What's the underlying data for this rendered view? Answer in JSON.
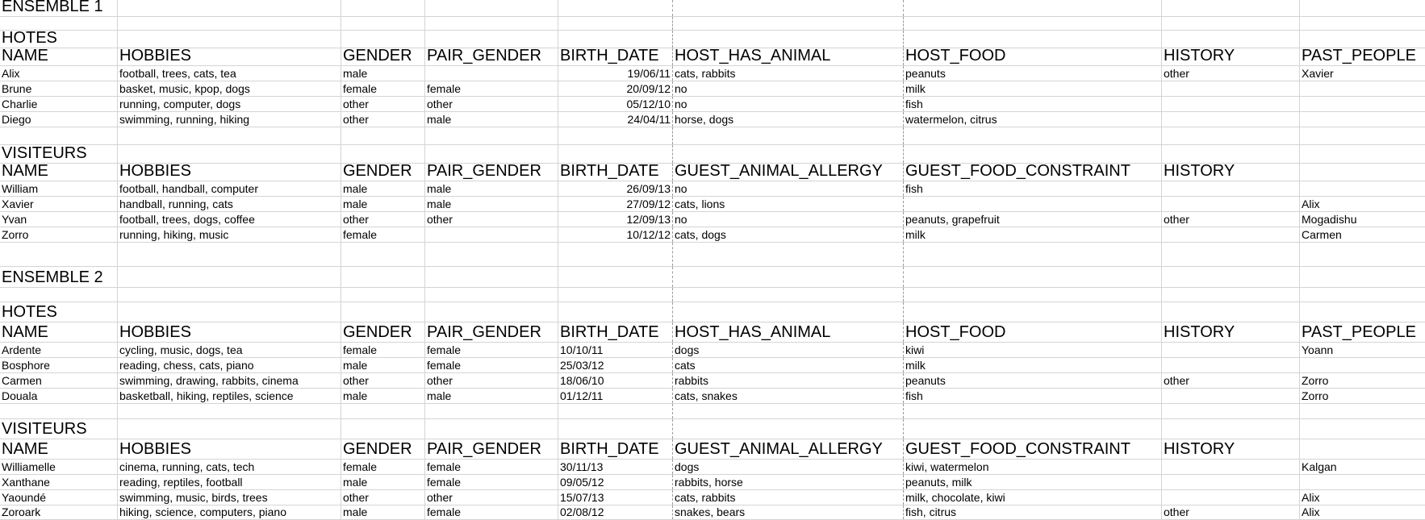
{
  "sheet": {
    "ensemble1": {
      "title": "ENSEMBLE 1",
      "hotes": {
        "title": "HOTES",
        "headers": [
          "NAME",
          "HOBBIES",
          "GENDER",
          "PAIR_GENDER",
          "BIRTH_DATE",
          "HOST_HAS_ANIMAL",
          "HOST_FOOD",
          "HISTORY",
          "PAST_PEOPLE"
        ],
        "rows": [
          [
            "Alix",
            "football, trees, cats, tea",
            "male",
            "",
            "19/06/11",
            "cats, rabbits",
            "peanuts",
            "other",
            "Xavier"
          ],
          [
            "Brune",
            "basket, music, kpop, dogs",
            "female",
            "female",
            "20/09/12",
            "no",
            "milk",
            "",
            ""
          ],
          [
            "Charlie",
            "running, computer, dogs",
            "other",
            "other",
            "05/12/10",
            "no",
            "fish",
            "",
            ""
          ],
          [
            "Diego",
            "swimming, running, hiking",
            "other",
            "male",
            "24/04/11",
            "horse, dogs",
            "watermelon, citrus",
            "",
            ""
          ]
        ]
      },
      "visiteurs": {
        "title": "VISITEURS",
        "headers": [
          "NAME",
          "HOBBIES",
          "GENDER",
          "PAIR_GENDER",
          "BIRTH_DATE",
          "GUEST_ANIMAL_ALLERGY",
          "GUEST_FOOD_CONSTRAINT",
          "HISTORY",
          ""
        ],
        "rows": [
          [
            "William",
            "football, handball, computer",
            "male",
            "male",
            "26/09/13",
            "no",
            "fish",
            "",
            ""
          ],
          [
            "Xavier",
            "handball, running, cats",
            "male",
            "male",
            "27/09/12",
            "cats, lions",
            "",
            "",
            "Alix"
          ],
          [
            "Yvan",
            "football, trees, dogs, coffee",
            "other",
            "other",
            "12/09/13",
            "no",
            "peanuts, grapefruit",
            "other",
            "Mogadishu"
          ],
          [
            "Zorro",
            "running, hiking, music",
            "female",
            "",
            "10/12/12",
            "cats, dogs",
            "milk",
            "",
            "Carmen"
          ]
        ]
      }
    },
    "ensemble2": {
      "title": "ENSEMBLE 2",
      "hotes": {
        "title": "HOTES",
        "headers": [
          "NAME",
          "HOBBIES",
          "GENDER",
          "PAIR_GENDER",
          "BIRTH_DATE",
          "HOST_HAS_ANIMAL",
          "HOST_FOOD",
          "HISTORY",
          "PAST_PEOPLE"
        ],
        "rows": [
          [
            "Ardente",
            "cycling, music, dogs, tea",
            "female",
            "female",
            "10/10/11",
            "dogs",
            "kiwi",
            "",
            "Yoann"
          ],
          [
            "Bosphore",
            "reading, chess, cats, piano",
            "male",
            "female",
            "25/03/12",
            "cats",
            "milk",
            "",
            ""
          ],
          [
            "Carmen",
            "swimming, drawing, rabbits, cinema",
            "other",
            "other",
            "18/06/10",
            "rabbits",
            "peanuts",
            "other",
            "Zorro"
          ],
          [
            "Douala",
            "basketball, hiking, reptiles, science",
            "male",
            "male",
            "01/12/11",
            "cats, snakes",
            "fish",
            "",
            "Zorro"
          ]
        ]
      },
      "visiteurs": {
        "title": "VISITEURS",
        "headers": [
          "NAME",
          "HOBBIES",
          "GENDER",
          "PAIR_GENDER",
          "BIRTH_DATE",
          "GUEST_ANIMAL_ALLERGY",
          "GUEST_FOOD_CONSTRAINT",
          "HISTORY",
          ""
        ],
        "rows": [
          [
            "Williamelle",
            "cinema, running, cats, tech",
            "female",
            "female",
            "30/11/13",
            "dogs",
            "kiwi, watermelon",
            "",
            "Kalgan"
          ],
          [
            "Xanthane",
            "reading, reptiles, football",
            "male",
            "female",
            "09/05/12",
            "rabbits, horse",
            "peanuts, milk",
            "",
            ""
          ],
          [
            "Yaoundé",
            "swimming, music, birds, trees",
            "other",
            "other",
            "15/07/13",
            "cats, rabbits",
            "milk, chocolate, kiwi",
            "",
            "Alix"
          ],
          [
            "Zoroark",
            "hiking, science, computers, piano",
            "male",
            "female",
            "02/08/12",
            "snakes, bears",
            "fish, citrus",
            "other",
            "Alix"
          ]
        ]
      }
    }
  }
}
